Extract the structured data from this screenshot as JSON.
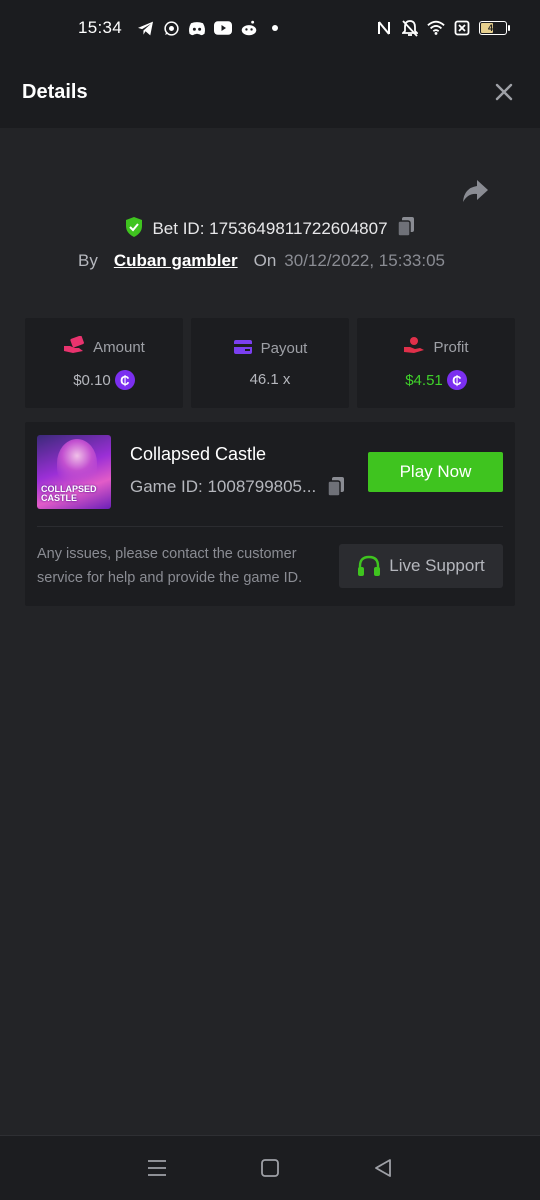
{
  "status_bar": {
    "time": "15:34",
    "battery_level": "46",
    "left_icons": [
      "telegram-icon",
      "whatsapp-icon",
      "discord-icon",
      "youtube-icon",
      "reddit-icon",
      "dot-icon"
    ],
    "right_icons": [
      "nfc-icon",
      "mute-icon",
      "wifi-icon",
      "no-sim-icon",
      "battery-icon"
    ]
  },
  "header": {
    "title": "Details"
  },
  "bet": {
    "bet_id_text": "Bet ID: 1753649811722604807",
    "by_label": "By",
    "username": "Cuban gambler",
    "on_label": "On",
    "date": "30/12/2022, 15:33:05"
  },
  "stats": {
    "amount_label": "Amount",
    "amount_value": "$0.10",
    "payout_label": "Payout",
    "payout_value": "46.1 x",
    "profit_label": "Profit",
    "profit_value": "$4.51",
    "coin_symbol": "₵"
  },
  "game": {
    "thumb_text": "COLLAPSED CASTLE",
    "name": "Collapsed Castle",
    "game_id": "Game ID: 1008799805...",
    "play_label": "Play Now",
    "support_text": "Any issues, please contact the customer service for help and provide the game ID.",
    "live_support_label": "Live Support"
  },
  "colors": {
    "background": "#232427",
    "card": "#1c1d20",
    "accent_green": "#3fc41f",
    "coin_purple": "#7b2ff0",
    "amount_icon": "#e8336e",
    "payout_icon": "#7b3ff0",
    "profit_icon": "#e0304a"
  }
}
